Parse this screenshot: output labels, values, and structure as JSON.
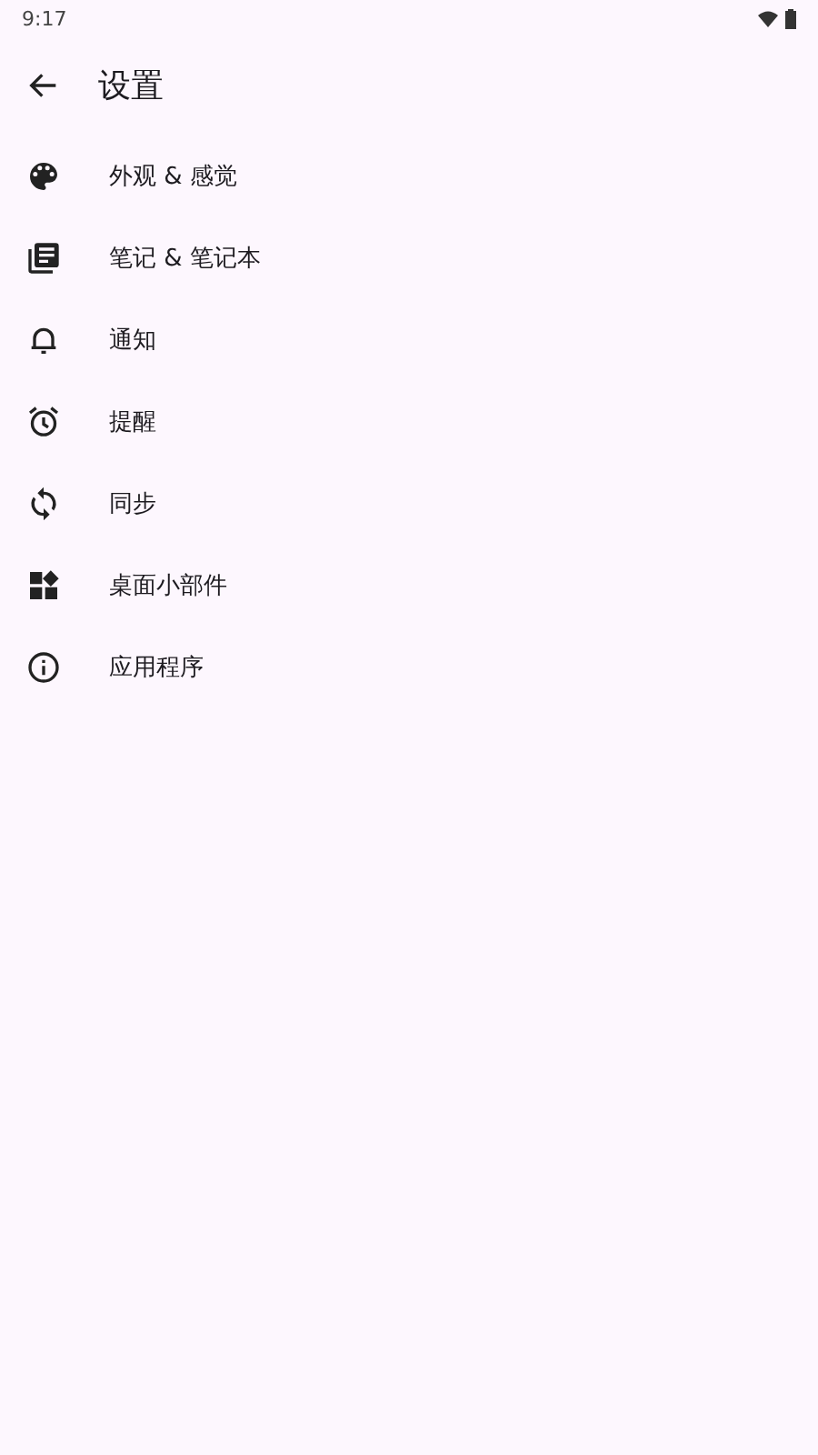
{
  "status_bar": {
    "time": "9:17"
  },
  "app_bar": {
    "title": "设置"
  },
  "items": [
    {
      "kind": "palette",
      "label": "外观 & 感觉"
    },
    {
      "kind": "notebook",
      "label": "笔记 & 笔记本"
    },
    {
      "kind": "bell",
      "label": "通知"
    },
    {
      "kind": "alarm",
      "label": "提醒"
    },
    {
      "kind": "sync",
      "label": "同步"
    },
    {
      "kind": "widgets",
      "label": "桌面小部件"
    },
    {
      "kind": "info",
      "label": "应用程序"
    }
  ]
}
